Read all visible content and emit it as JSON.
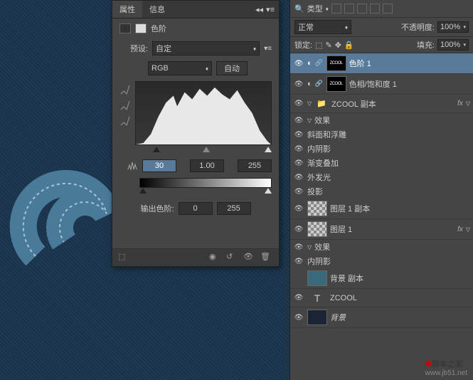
{
  "tabs": {
    "properties": "属性",
    "info": "信息"
  },
  "panel": {
    "title": "色阶",
    "preset_lbl": "预设:",
    "preset": "自定",
    "channel": "RGB",
    "auto": "自动",
    "in_black": "30",
    "in_mid": "1.00",
    "in_white": "255",
    "output_lbl": "输出色阶:",
    "out_black": "0",
    "out_white": "255"
  },
  "layertop": {
    "kind": "类型"
  },
  "blend": {
    "mode": "正常",
    "opacity_lbl": "不透明度:",
    "opacity": "100%"
  },
  "lock": {
    "lbl": "锁定:",
    "fill_lbl": "填充:",
    "fill": "100%"
  },
  "layers": [
    {
      "name": "色阶 1",
      "sel": true,
      "link": true,
      "thumb": "zcool"
    },
    {
      "name": "色相/饱和度 1",
      "link": true,
      "thumb": "zcool"
    },
    {
      "name": "ZCOOL 副本",
      "group": true,
      "fx": true
    },
    {
      "name": "效果",
      "indent": 1,
      "expand": true
    },
    {
      "name": "斜面和浮雕",
      "indent": 2,
      "eff": true
    },
    {
      "name": "内阴影",
      "indent": 2,
      "eff": true
    },
    {
      "name": "渐变叠加",
      "indent": 2,
      "eff": true
    },
    {
      "name": "外发光",
      "indent": 2,
      "eff": true
    },
    {
      "name": "投影",
      "indent": 2,
      "eff": true
    },
    {
      "name": "图层 1 副本",
      "thumb": "checker"
    },
    {
      "name": "图层 1",
      "thumb": "checker",
      "fx": true
    },
    {
      "name": "效果",
      "indent": 1,
      "expand": true
    },
    {
      "name": "内阴影",
      "indent": 2,
      "eff": true
    },
    {
      "name": "背景 副本",
      "thumb": "teal",
      "noeye": true
    },
    {
      "name": "ZCOOL",
      "type": "T"
    },
    {
      "name": "背景",
      "thumb": "dark",
      "italic": true
    }
  ],
  "watermark": {
    "text": "脚本之家",
    "url": "www.jb51.net"
  }
}
